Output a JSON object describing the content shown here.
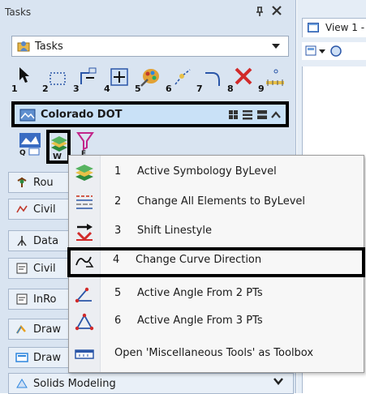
{
  "tasks_panel": {
    "title": "Tasks",
    "task_dropdown": {
      "value": "Tasks"
    },
    "toolbar_numbers": [
      "1",
      "2",
      "3",
      "4",
      "5",
      "6",
      "7",
      "8",
      "9"
    ],
    "group": {
      "title": "Colorado DOT"
    },
    "side_items": [
      {
        "label": "Rou",
        "icon": "road-icon"
      },
      {
        "label": "Civil",
        "icon": "civil-icon"
      },
      {
        "label": "Data",
        "icon": "survey-icon"
      },
      {
        "label": "Civil",
        "icon": "civil-doc-icon"
      },
      {
        "label": "InRo",
        "icon": "inroads-icon"
      },
      {
        "label": "Draw",
        "icon": "drawing-icon"
      },
      {
        "label": "Draw",
        "icon": "drawing-sheet-icon"
      },
      {
        "label": "Solids Modeling",
        "icon": "solids-icon"
      }
    ]
  },
  "view_panel": {
    "tab_label": "View 1 -"
  },
  "context_menu": {
    "items": [
      {
        "num": "1",
        "label": "Active Symbology ByLevel",
        "icon": "layers-icon"
      },
      {
        "num": "2",
        "label": "Change All Elements to ByLevel",
        "icon": "level-lines-icon"
      },
      {
        "num": "3",
        "label": "Shift Linestyle",
        "icon": "linestyle-arrow-icon"
      },
      {
        "num": "4",
        "label": "Change Curve Direction",
        "icon": "curve-direction-icon"
      },
      {
        "num": "5",
        "label": "Active Angle From 2 PTs",
        "icon": "angle-2pt-icon"
      },
      {
        "num": "6",
        "label": "Active Angle From 3 PTs",
        "icon": "angle-3pt-icon"
      },
      {
        "num": "",
        "label": "Open 'Miscellaneous Tools' as Toolbox",
        "icon": "toolbox-icon"
      }
    ]
  },
  "colors": {
    "highlight_border": "#000000",
    "panel_bg": "#d9e4f1",
    "group_header_bg": "#c9e1f7",
    "menu_bg": "#f7f7f7"
  }
}
